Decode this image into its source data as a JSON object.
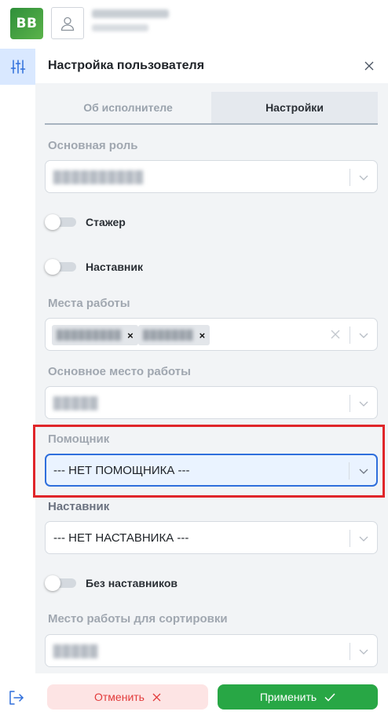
{
  "header": {
    "logo_text": "BB",
    "user_icon": "user-icon"
  },
  "rail": {
    "settings_icon": "sliders-icon",
    "logout_icon": "logout-icon"
  },
  "panel": {
    "title": "Настройка пользователя",
    "close_icon": "close-icon",
    "tabs": [
      {
        "label": "Об исполнителе",
        "active": false
      },
      {
        "label": "Настройки",
        "active": true
      }
    ],
    "fields": {
      "main_role": {
        "label": "Основная роль"
      },
      "intern": {
        "label": "Стажер",
        "on": false
      },
      "mentor_toggle": {
        "label": "Наставник",
        "on": false
      },
      "workplaces": {
        "label": "Места работы"
      },
      "main_workplace": {
        "label": "Основное место работы"
      },
      "assistant": {
        "label": "Помощник",
        "value": "--- НЕТ ПОМОЩНИКА ---"
      },
      "mentor": {
        "label": "Наставник",
        "value": "--- НЕТ НАСТАВНИКА ---"
      },
      "no_mentors": {
        "label": "Без наставников",
        "on": false
      },
      "sort_workplace": {
        "label": "Место работы для сортировки"
      }
    }
  },
  "footer": {
    "cancel_label": "Отменить",
    "apply_label": "Применить"
  },
  "colors": {
    "logo_green": "#2f8f3a",
    "apply_green": "#28a745",
    "cancel_bg": "#fde4e4",
    "cancel_text": "#e23b3b",
    "focus_blue": "#2f6fdc",
    "highlight_red": "#e0262a"
  }
}
